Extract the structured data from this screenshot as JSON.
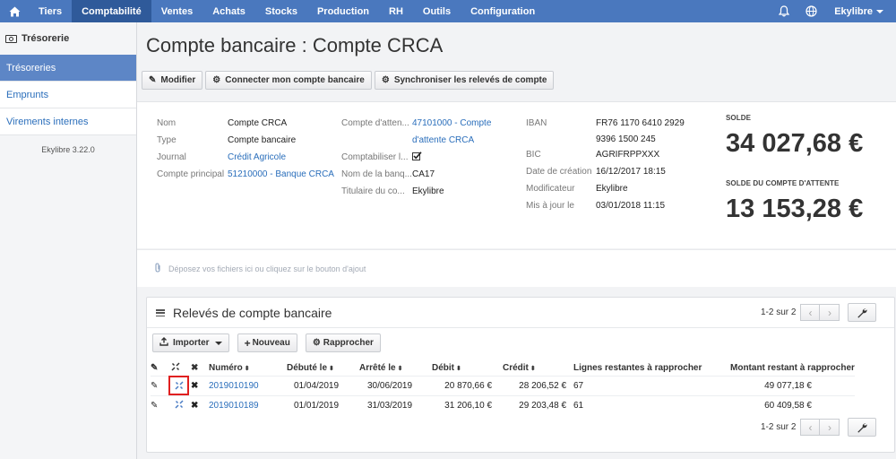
{
  "topnav": {
    "items": [
      "Tiers",
      "Comptabilité",
      "Ventes",
      "Achats",
      "Stocks",
      "Production",
      "RH",
      "Outils",
      "Configuration"
    ],
    "active_index": 1,
    "user": "Ekylibre"
  },
  "sidebar": {
    "title": "Trésorerie",
    "items": [
      {
        "label": "Trésoreries",
        "active": true
      },
      {
        "label": "Emprunts",
        "active": false
      },
      {
        "label": "Virements internes",
        "active": false
      }
    ],
    "version": "Ekylibre 3.22.0"
  },
  "page": {
    "title": "Compte bancaire : Compte CRCA"
  },
  "toolbar": {
    "modifier": "Modifier",
    "connect": "Connecter mon compte bancaire",
    "sync": "Synchroniser les relevés de compte"
  },
  "details": {
    "col1": [
      {
        "label": "Nom",
        "value": "Compte CRCA",
        "link": false
      },
      {
        "label": "Type",
        "value": "Compte bancaire",
        "link": false
      },
      {
        "label": "Journal",
        "value": "Crédit Agricole",
        "link": true
      },
      {
        "label": "Compte principal",
        "value": "51210000 - Banque CRCA",
        "link": true
      }
    ],
    "col2": {
      "attente_label": "Compte d'atten...",
      "attente_line1": "47101000 - Compte",
      "attente_line2": "d'attente CRCA",
      "comptabiliser_label": "Comptabiliser l...",
      "comptabiliser_checked": true,
      "banque_label": "Nom de la banq...",
      "banque_value": "CA17",
      "titulaire_label": "Titulaire du co...",
      "titulaire_value": "Ekylibre"
    },
    "col3": {
      "iban_label": "IBAN",
      "iban_line1": "FR76 1170 6410 2929",
      "iban_line2": "9396 1500 245",
      "rows": [
        {
          "label": "BIC",
          "value": "AGRIFRPPXXX"
        },
        {
          "label": "Date de création",
          "value": "16/12/2017 18:15"
        },
        {
          "label": "Modificateur",
          "value": "Ekylibre"
        },
        {
          "label": "Mis à jour le",
          "value": "03/01/2018 11:15"
        }
      ]
    },
    "solde_caption": "SOLDE",
    "solde_amount": "34 027,68 €",
    "solde_attente_caption": "SOLDE DU COMPTE D'ATTENTE",
    "solde_attente_amount": "13 153,28 €"
  },
  "dropzone": {
    "text": "Déposez vos fichiers ici ou cliquez sur le bouton d'ajout"
  },
  "releves": {
    "title": "Relevés de compte bancaire",
    "pager_text": "1-2 sur 2",
    "import_label": "Importer",
    "nouveau_label": "Nouveau",
    "rapprocher_label": "Rapprocher",
    "headers": {
      "numero": "Numéro",
      "debute": "Débuté le",
      "arrete": "Arrêté le",
      "debit": "Débit",
      "credit": "Crédit",
      "lignes": "Lignes restantes à rapprocher",
      "montant": "Montant restant à rapprocher"
    },
    "rows": [
      {
        "numero": "2019010190",
        "debute": "01/04/2019",
        "arrete": "30/06/2019",
        "debit": "20 870,66 €",
        "credit": "28 206,52 €",
        "lignes": "67",
        "montant": "49 077,18 €"
      },
      {
        "numero": "2019010189",
        "debute": "01/01/2019",
        "arrete": "31/03/2019",
        "debit": "31 206,10 €",
        "credit": "29 203,48 €",
        "lignes": "61",
        "montant": "60 409,58 €"
      }
    ]
  }
}
